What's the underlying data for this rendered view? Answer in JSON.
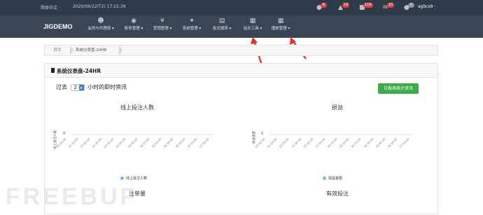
{
  "topbar": {
    "lang": "简体中文 ·",
    "time": "2020/06/22(T2) 17:22:39",
    "notifications": [
      {
        "icon": "user-icon",
        "count": "8"
      },
      {
        "icon": "gift-icon",
        "count": "19"
      },
      {
        "icon": "cart-icon",
        "count": "116"
      },
      {
        "icon": "mail-icon",
        "count": "15"
      },
      {
        "icon": "person-icon",
        "count": "1"
      }
    ],
    "user": "agbcs9 ·"
  },
  "nav": {
    "brand": "JIGDEMO",
    "items": [
      {
        "icon": "members-icon",
        "label": "会员与代理商 ▾"
      },
      {
        "icon": "piggy-bank-icon",
        "label": "账务管理 ▾"
      },
      {
        "icon": "yen-icon",
        "label": "营销管理 ▾"
      },
      {
        "icon": "wrench-icon",
        "label": "系统管理 ▾"
      },
      {
        "icon": "report-icon",
        "label": "各式报表 ▾"
      },
      {
        "icon": "grid-icon",
        "label": "站长工具 ▾"
      },
      {
        "icon": "grid-icon",
        "label": "播放管理 ▾"
      }
    ]
  },
  "breadcrumb": {
    "home": "首页",
    "current": "系统仪表盘-24HR"
  },
  "panel": {
    "title": "系统仪表盘-24HR",
    "filter_prefix": "过去",
    "filter_value": "2",
    "filter_suffix": "小时的即时资讯",
    "stat_button": "日报表统计资讯"
  },
  "charts": {
    "left": {
      "title": "线上投注人数",
      "ylabel": "线上投注人数",
      "legend": "线上投注人数",
      "zero": "0"
    },
    "right": {
      "title": "损益",
      "ylabel": "损益金额",
      "legend": "损益金额",
      "zero": "0"
    },
    "bottom_left_title": "注单量",
    "bottom_right_title": "有效投注"
  },
  "chart_data": [
    {
      "type": "line",
      "title": "线上投注人数",
      "ylabel": "线上投注人数",
      "x": [
        "15:00:00",
        "15:10:00",
        "15:20:00",
        "15:30:00",
        "15:40:00",
        "15:50:00",
        "16:00:00",
        "16:10:00",
        "16:20:00",
        "16:30:00",
        "16:40:00",
        "16:50:00",
        "17:00:00"
      ],
      "series": [
        {
          "name": "线上投注人数",
          "values": []
        }
      ],
      "yticks": [
        "0"
      ],
      "legend": "bottom"
    },
    {
      "type": "line",
      "title": "损益",
      "ylabel": "损益金额",
      "x": [
        "15:00:00",
        "15:10:00",
        "15:20:00",
        "15:30:00",
        "15:40:00",
        "15:50:00",
        "16:00:00",
        "16:10:00",
        "16:20:00",
        "16:30:00",
        "16:40:00",
        "16:50:00",
        "17:00:00"
      ],
      "series": [
        {
          "name": "损益金额",
          "values": []
        }
      ],
      "yticks": [
        "0"
      ],
      "legend": "bottom"
    }
  ],
  "watermark": "FREEBUF",
  "colors": {
    "topbar": "#2f3b48",
    "nav": "#3a4654",
    "accent": "#3b7dd8",
    "button": "#3eaa49",
    "badge": "#e04242",
    "series": "#7cb5ec",
    "arrow": "#e8301c"
  }
}
